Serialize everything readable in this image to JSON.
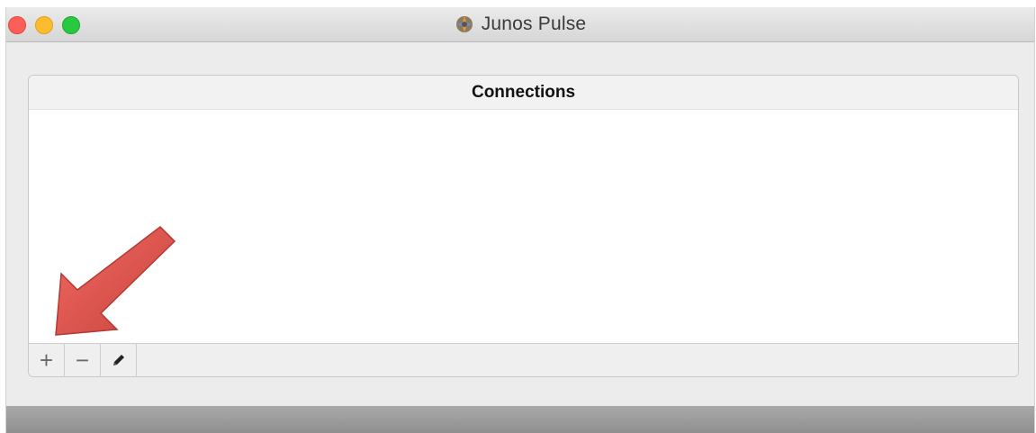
{
  "window": {
    "title": "Junos Pulse",
    "app_icon": "junos-pulse-icon"
  },
  "panel": {
    "title": "Connections",
    "connections": []
  },
  "toolbar": {
    "add_label": "+",
    "remove_label": "−",
    "edit_icon": "pencil-icon"
  },
  "colors": {
    "close": "#fc5f57",
    "minimize": "#fdbc2e",
    "zoom": "#28c840",
    "annotation_arrow": "#e0504a"
  }
}
